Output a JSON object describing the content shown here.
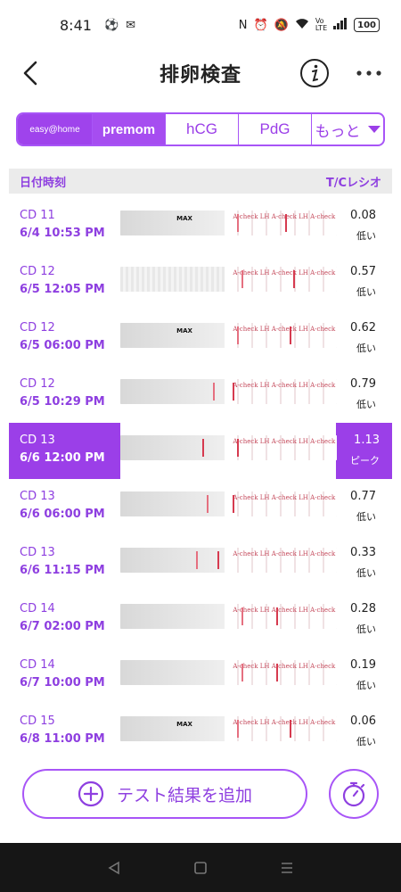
{
  "status_bar": {
    "time": "8:41",
    "left_icons": [
      "soccer-ball-icon",
      "mail-icon"
    ],
    "right_icons": [
      "nfc-icon",
      "alarm-icon",
      "mute-icon",
      "wifi-icon",
      "volte-icon",
      "signal-icon"
    ],
    "battery": "100"
  },
  "header": {
    "title": "排卵検査",
    "back_icon": "chevron-left-icon",
    "info_icon": "info-icon",
    "more_icon": "more-horizontal-icon"
  },
  "tabs": [
    {
      "label": "easy@home",
      "selected": true
    },
    {
      "label": "premom",
      "selected": false
    },
    {
      "label": "hCG",
      "selected": false
    },
    {
      "label": "PdG",
      "selected": false
    },
    {
      "label": "もっと",
      "selected": false
    }
  ],
  "list": {
    "col_date": "日付時刻",
    "col_ratio": "T/Cレシオ",
    "rows": [
      {
        "cd": "CD 11",
        "datetime": "6/4  10:53 PM",
        "ratio": "0.08",
        "level": "低い",
        "peak": false
      },
      {
        "cd": "CD 12",
        "datetime": "6/5  12:05 PM",
        "ratio": "0.57",
        "level": "低い",
        "peak": false
      },
      {
        "cd": "CD 12",
        "datetime": "6/5  06:00 PM",
        "ratio": "0.62",
        "level": "低い",
        "peak": false
      },
      {
        "cd": "CD 12",
        "datetime": "6/5  10:29 PM",
        "ratio": "0.79",
        "level": "低い",
        "peak": false
      },
      {
        "cd": "CD 13",
        "datetime": "6/6  12:00 PM",
        "ratio": "1.13",
        "level": "ピーク",
        "peak": true
      },
      {
        "cd": "CD 13",
        "datetime": "6/6  06:00 PM",
        "ratio": "0.77",
        "level": "低い",
        "peak": false
      },
      {
        "cd": "CD 13",
        "datetime": "6/6  11:15 PM",
        "ratio": "0.33",
        "level": "低い",
        "peak": false
      },
      {
        "cd": "CD 14",
        "datetime": "6/7  02:00 PM",
        "ratio": "0.28",
        "level": "低い",
        "peak": false
      },
      {
        "cd": "CD 14",
        "datetime": "6/7  10:00 PM",
        "ratio": "0.19",
        "level": "低い",
        "peak": false
      },
      {
        "cd": "CD 15",
        "datetime": "6/8  11:00 PM",
        "ratio": "0.06",
        "level": "低い",
        "peak": false
      }
    ],
    "strip_text": "A-check LH  A-check LH  A-check LH",
    "strip_max": "MAX"
  },
  "actions": {
    "add_label": "テスト結果を追加",
    "timer_icon": "stopwatch-icon"
  },
  "colors": {
    "accent": "#9b3fe8",
    "accent_light": "#a855f7",
    "list_header_bg": "#ebebeb"
  }
}
